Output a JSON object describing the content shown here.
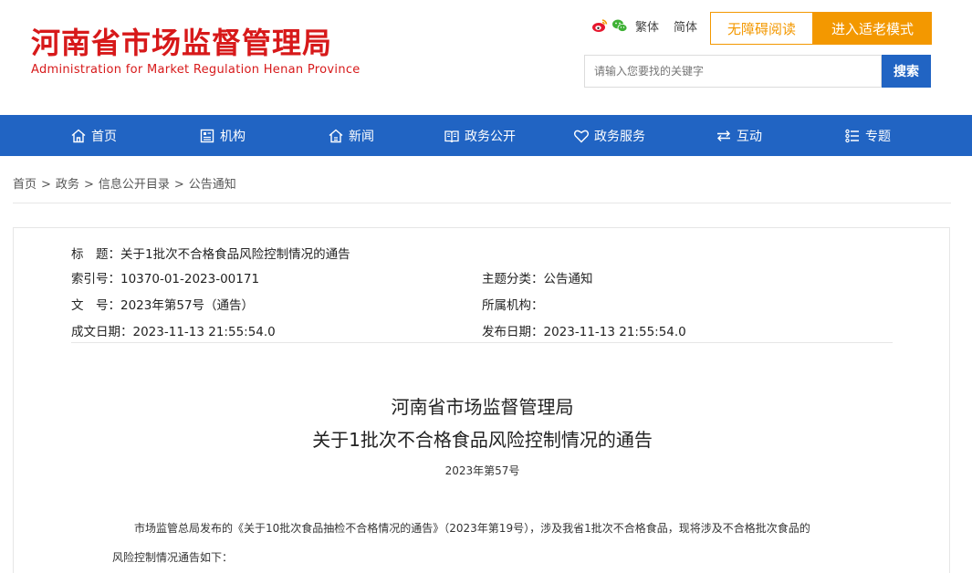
{
  "header": {
    "logo_cn": "河南省市场监督管理局",
    "logo_en": "Administration for Market Regulation Henan Province",
    "lang_traditional": "繁体",
    "lang_simplified": "简体",
    "accessible_label": "无障碍阅读",
    "elder_mode_label": "进入适老模式",
    "search_placeholder": "请输入您要找的关键字",
    "search_button": "搜索"
  },
  "nav": {
    "items": [
      {
        "label": "首页",
        "icon": "home-icon"
      },
      {
        "label": "机构",
        "icon": "org-icon"
      },
      {
        "label": "新闻",
        "icon": "news-icon"
      },
      {
        "label": "政务公开",
        "icon": "open-gov-icon"
      },
      {
        "label": "政务服务",
        "icon": "heart-icon"
      },
      {
        "label": "互动",
        "icon": "interaction-icon"
      },
      {
        "label": "专题",
        "icon": "topic-icon"
      }
    ]
  },
  "breadcrumb": {
    "items": [
      "首页",
      "政务",
      "信息公开目录",
      "公告通知"
    ],
    "separator": ">"
  },
  "meta": {
    "title_label": "标　题：",
    "title_value": "关于1批次不合格食品风险控制情况的通告",
    "index_label": "索引号：",
    "index_value": "10370-01-2023-00171",
    "category_label": "主题分类：",
    "category_value": "公告通知",
    "docno_label": "文　号：",
    "docno_value": "2023年第57号（通告）",
    "org_label": "所属机构：",
    "org_value": "",
    "created_label": "成文日期：",
    "created_value": "2023-11-13 21:55:54.0",
    "published_label": "发布日期：",
    "published_value": "2023-11-13 21:55:54.0"
  },
  "document": {
    "title_line1": "河南省市场监督管理局",
    "title_line2": "关于1批次不合格食品风险控制情况的通告",
    "number": "2023年第57号",
    "paragraph1": "市场监管总局发布的《关于10批次食品抽检不合格情况的通告》（2023年第19号），涉及我省1批次不合格食品，现将涉及不合格批次食品的",
    "paragraph2": "风险控制情况通告如下："
  },
  "colors": {
    "brand_red": "#d7191a",
    "nav_blue": "#2164c3",
    "accent_orange": "#f39800"
  }
}
